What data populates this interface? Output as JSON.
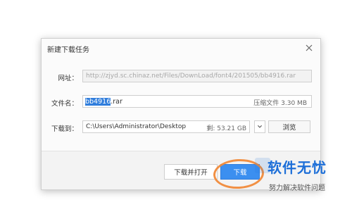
{
  "dialog": {
    "title": "新建下载任务",
    "url_label": "网址：",
    "url_value": "http://zjyd.sc.chinaz.net/Files/DownLoad/font4/201505/bb4916.rar",
    "filename_label": "文件名：",
    "filename_selected": "bb4916",
    "filename_ext": ".rar",
    "file_meta": "压缩文件 3.30 MB",
    "download_to_label": "下载到：",
    "path_value": "C:\\Users\\Administrator\\Desktop",
    "free_space": "剩: 53.21 GB",
    "browse_label": "浏览",
    "btn_download_open": "下载并打开",
    "btn_download": "下载"
  },
  "watermark": {
    "title": "软件无忧",
    "subtitle": "努力解决软件问题"
  },
  "colors": {
    "accent_blue": "#3b8ff0",
    "highlight_orange": "#f08a3a",
    "watermark_blue": "#1d6fd8"
  },
  "icons": {
    "close": "close-icon",
    "dropdown": "chevron-down-icon"
  }
}
